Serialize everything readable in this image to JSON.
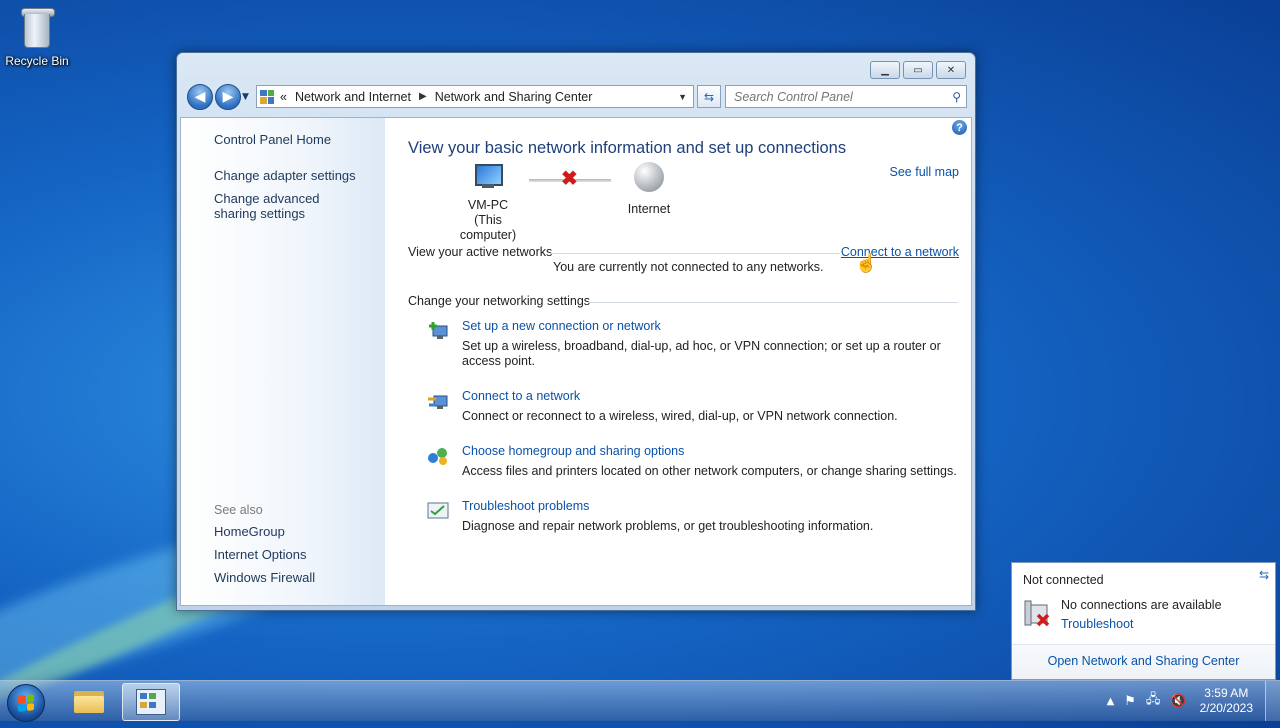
{
  "desktop": {
    "recycle_bin_label": "Recycle Bin"
  },
  "window": {
    "breadcrumb": {
      "overflow": "«",
      "items": [
        "Network and Internet",
        "Network and Sharing Center"
      ]
    },
    "search_placeholder": "Search Control Panel",
    "sidebar": {
      "links": [
        "Control Panel Home",
        "Change adapter settings",
        "Change advanced sharing settings"
      ],
      "see_also_label": "See also",
      "see_also_links": [
        "HomeGroup",
        "Internet Options",
        "Windows Firewall"
      ]
    },
    "main": {
      "heading": "View your basic network information and set up connections",
      "see_full_map": "See full map",
      "computer_name": "VM-PC",
      "computer_sub": "(This computer)",
      "internet_label": "Internet",
      "active_networks_label": "View your active networks",
      "connect_link": "Connect to a network",
      "not_connected_msg": "You are currently not connected to any networks.",
      "settings_label": "Change your networking settings",
      "tasks": [
        {
          "link": "Set up a new connection or network",
          "desc": "Set up a wireless, broadband, dial-up, ad hoc, or VPN connection; or set up a router or access point."
        },
        {
          "link": "Connect to a network",
          "desc": "Connect or reconnect to a wireless, wired, dial-up, or VPN network connection."
        },
        {
          "link": "Choose homegroup and sharing options",
          "desc": "Access files and printers located on other network computers, or change sharing settings."
        },
        {
          "link": "Troubleshoot problems",
          "desc": "Diagnose and repair network problems, or get troubleshooting information."
        }
      ]
    }
  },
  "flyout": {
    "title": "Not connected",
    "message": "No connections are available",
    "troubleshoot": "Troubleshoot",
    "footer_link": "Open Network and Sharing Center"
  },
  "taskbar": {
    "time": "3:59 AM",
    "date": "2/20/2023"
  },
  "colors": {
    "link": "#0a52a8",
    "heading": "#1e3f7a",
    "error_x": "#d21a1a"
  }
}
